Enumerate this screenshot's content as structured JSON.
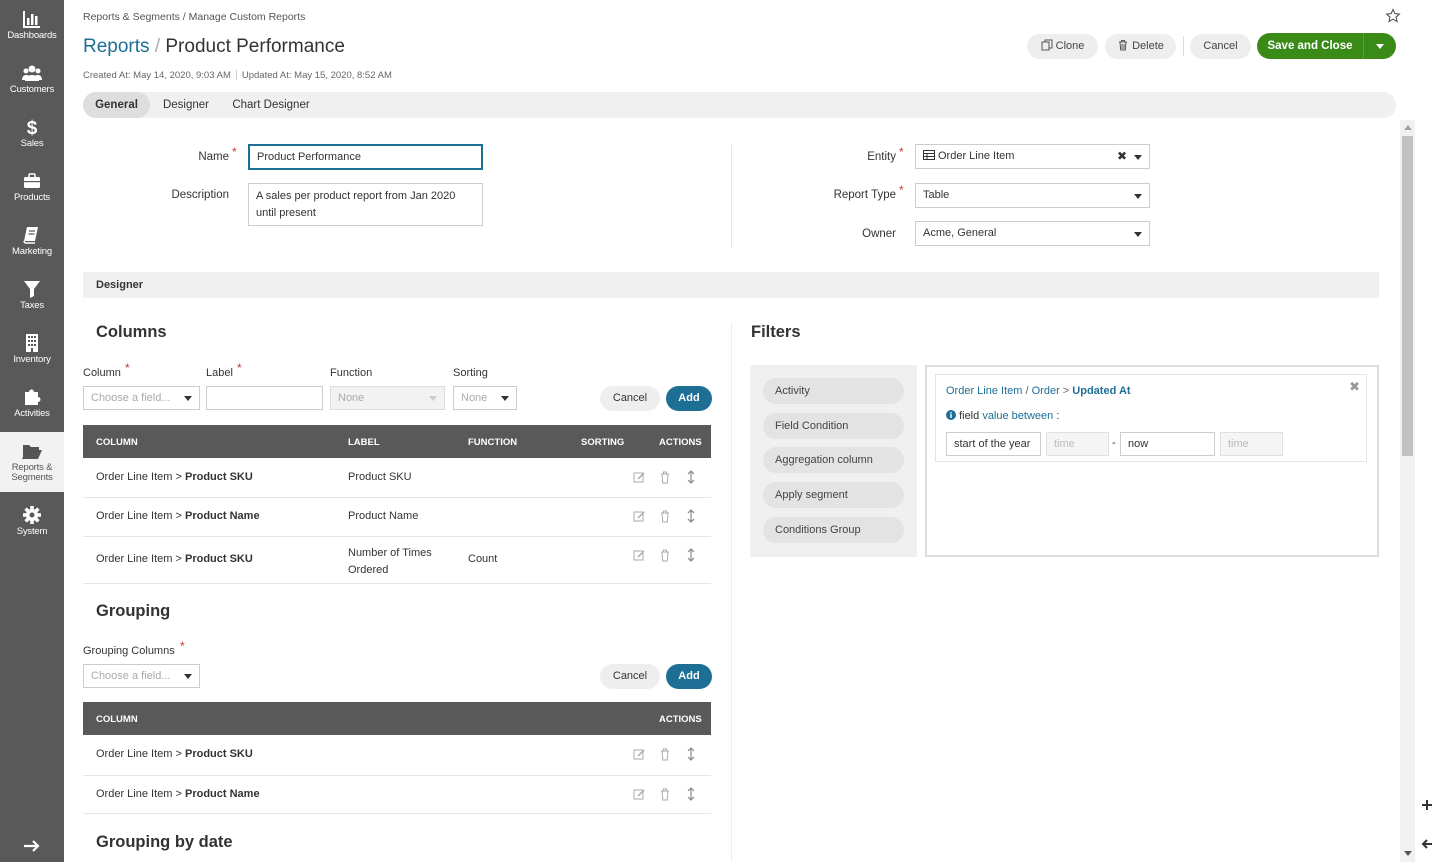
{
  "sidebar": {
    "items": [
      {
        "label": "Dashboards"
      },
      {
        "label": "Customers"
      },
      {
        "label": "Sales"
      },
      {
        "label": "Products"
      },
      {
        "label": "Marketing"
      },
      {
        "label": "Taxes"
      },
      {
        "label": "Inventory"
      },
      {
        "label": "Activities"
      },
      {
        "label": "Reports & Segments"
      },
      {
        "label": "System"
      }
    ]
  },
  "header": {
    "breadcrumb": "Reports & Segments / Manage Custom Reports",
    "title_link": "Reports",
    "title_sep": "/",
    "title": "Product Performance",
    "created": "Created At: May 14, 2020, 9:03 AM",
    "updated": "Updated At: May 15, 2020, 8:52 AM",
    "clone_label": "Clone",
    "delete_label": "Delete",
    "cancel_label": "Cancel",
    "save_label": "Save and Close"
  },
  "tabs": [
    {
      "label": "General"
    },
    {
      "label": "Designer"
    },
    {
      "label": "Chart Designer"
    }
  ],
  "general": {
    "name_label": "Name",
    "name_value": "Product Performance",
    "description_label": "Description",
    "description_line1": "A sales per product report from Jan 2020",
    "description_line2": "until present",
    "entity_label": "Entity",
    "entity_value": "Order Line Item",
    "report_type_label": "Report Type",
    "report_type_value": "Table",
    "owner_label": "Owner",
    "owner_value": "Acme, General"
  },
  "designer": {
    "section_label": "Designer",
    "columns": {
      "heading": "Columns",
      "column_label": "Column",
      "label_label": "Label",
      "function_label": "Function",
      "sorting_label": "Sorting",
      "column_placeholder": "Choose a field...",
      "function_value": "None",
      "sorting_value": "None",
      "cancel_label": "Cancel",
      "add_label": "Add",
      "headers": [
        "COLUMN",
        "LABEL",
        "FUNCTION",
        "SORTING",
        "ACTIONS"
      ],
      "rows": [
        {
          "path": "Order Line Item",
          "sep": ">",
          "field": "Product SKU",
          "label": "Product SKU",
          "label2": "",
          "function": ""
        },
        {
          "path": "Order Line Item",
          "sep": ">",
          "field": "Product Name",
          "label": "Product Name",
          "label2": "",
          "function": ""
        },
        {
          "path": "Order Line Item",
          "sep": ">",
          "field": "Product SKU",
          "label": "Number of Times",
          "label2": "Ordered",
          "function": "Count"
        }
      ]
    },
    "grouping": {
      "heading": "Grouping",
      "columns_label": "Grouping Columns",
      "placeholder": "Choose a field...",
      "cancel_label": "Cancel",
      "add_label": "Add",
      "headers": [
        "COLUMN",
        "ACTIONS"
      ],
      "rows": [
        {
          "path": "Order Line Item",
          "sep": ">",
          "field": "Product SKU"
        },
        {
          "path": "Order Line Item",
          "sep": ">",
          "field": "Product Name"
        }
      ]
    },
    "grouping_by_date": {
      "heading": "Grouping by date"
    },
    "filters": {
      "heading": "Filters",
      "items": [
        {
          "label": "Activity"
        },
        {
          "label": "Field Condition"
        },
        {
          "label": "Aggregation column"
        },
        {
          "label": "Apply segment"
        },
        {
          "label": "Conditions Group"
        }
      ],
      "condition": {
        "path_a": "Order Line Item",
        "path_sep1": "/",
        "path_b": "Order",
        "path_sep2": ">",
        "path_field": "Updated At",
        "op_prefix": "field",
        "op": "value between",
        "op_suffix": ":",
        "from_value": "start of the year",
        "from_time": "time",
        "dash": "-",
        "to_value": "now",
        "to_time": "time"
      }
    }
  },
  "colors": {
    "sidebar": "#595959",
    "accent": "#1e6f95",
    "save": "#3a8a18",
    "required": "#c8392e"
  }
}
